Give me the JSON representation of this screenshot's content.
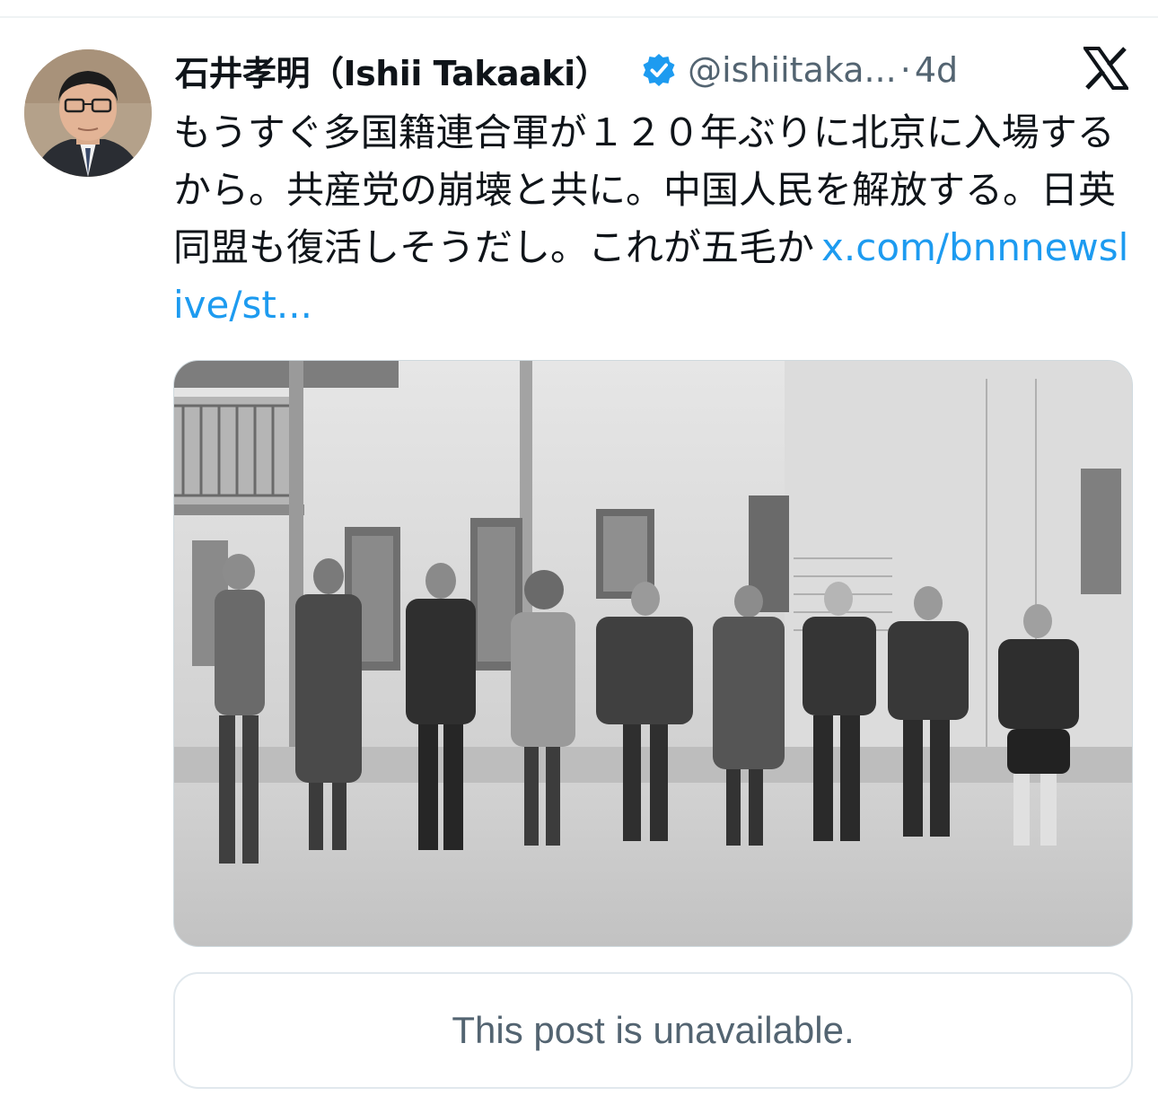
{
  "post": {
    "author": {
      "display_name": "石井孝明（Ishii Takaaki）",
      "handle": "@ishiitaka...",
      "verified": true
    },
    "separator": "·",
    "timestamp": "4d",
    "text": "もうすぐ多国籍連合軍が１２０年ぶりに北京に入場するから。共産党の崩壊と共に。中国人民を解放する。日英同盟も復活しそうだし。これが五毛か",
    "link_text": "x.com/bnnnewslive/st...",
    "quoted_post": {
      "message": "This post is unavailable."
    }
  },
  "icons": {
    "verified": "verified-badge-icon",
    "platform": "x-logo-icon"
  },
  "colors": {
    "link": "#1d9bf0",
    "secondary_text": "#536471",
    "verified": "#1d9bf0"
  }
}
